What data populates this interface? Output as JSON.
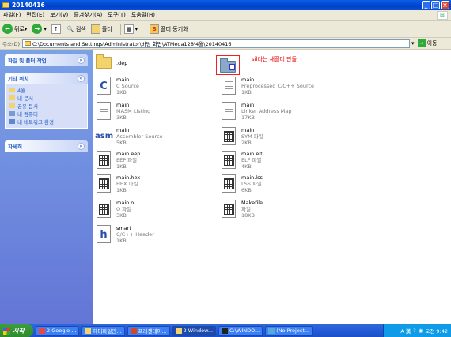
{
  "window": {
    "title": "20140416"
  },
  "menu": [
    "파일(F)",
    "편집(E)",
    "보기(V)",
    "즐겨찾기(A)",
    "도구(T)",
    "도움말(H)"
  ],
  "toolbar": {
    "back": "뒤로",
    "search": "검색",
    "folders": "폴더",
    "sync": "폴더 동기화"
  },
  "address": {
    "label": "주소(D)",
    "path": "C:\\Documents and Settings\\Administrator\\바탕 화면\\ATMega128\\4월\\20140416",
    "go": "이동"
  },
  "left": {
    "tasks": {
      "title": "파일 및 폴더 작업"
    },
    "places": {
      "title": "기타 위치",
      "items": [
        "4월",
        "내 문서",
        "공유 문서",
        "내 컴퓨터",
        "내 네트워크 환경"
      ]
    },
    "details": {
      "title": "자세히"
    }
  },
  "files": [
    {
      "name": ".dep",
      "type": "",
      "size": "",
      "icon": "folder"
    },
    {
      "name": "main",
      "type": "C Source",
      "size": "1KB",
      "icon": "c"
    },
    {
      "name": "main",
      "type": "Preprocessed C/C++ Source",
      "size": "1KB",
      "icon": "doc"
    },
    {
      "name": "main",
      "type": "MASM Listing",
      "size": "3KB",
      "icon": "doc"
    },
    {
      "name": "main",
      "type": "Linker Address Map",
      "size": "17KB",
      "icon": "doc"
    },
    {
      "name": "main",
      "type": "Assembler Source",
      "size": "5KB",
      "icon": "asm"
    },
    {
      "name": "main",
      "type": "SYM 파일",
      "size": "2KB",
      "icon": "grid"
    },
    {
      "name": "main.eep",
      "type": "EEP 파일",
      "size": "1KB",
      "icon": "grid"
    },
    {
      "name": "main.elf",
      "type": "ELF 파일",
      "size": "4KB",
      "icon": "grid"
    },
    {
      "name": "main.hex",
      "type": "HEX 파일",
      "size": "1KB",
      "icon": "grid"
    },
    {
      "name": "main.lss",
      "type": "LSS 파일",
      "size": "6KB",
      "icon": "grid"
    },
    {
      "name": "main.o",
      "type": "O 파일",
      "size": "3KB",
      "icon": "grid"
    },
    {
      "name": "Makefile",
      "type": "파일",
      "size": "18KB",
      "icon": "grid"
    },
    {
      "name": "smart",
      "type": "C/C++ Header",
      "size": "1KB",
      "icon": "h"
    }
  ],
  "annotation": "sil라는 새폴더 만듦.",
  "taskbar": {
    "start": "시작",
    "tasks": [
      "2 Google ...",
      "헤더파일만...",
      "프레젠테이...",
      "2 Window...",
      "C:\\WINDO...",
      "(No Project..."
    ],
    "tray": {
      "ime": "A 漢",
      "time": "오전 9:42"
    }
  }
}
